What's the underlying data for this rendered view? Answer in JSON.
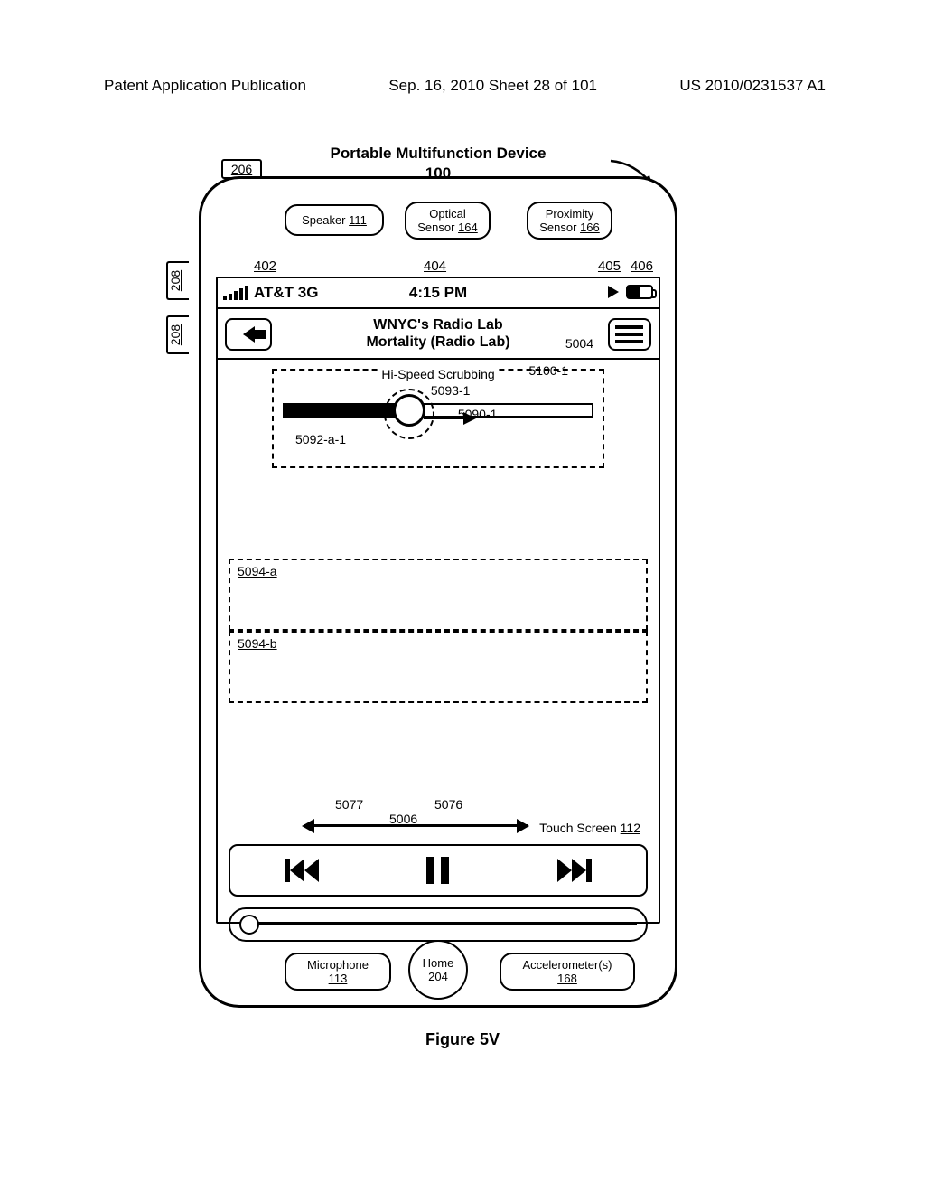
{
  "page_header": {
    "left": "Patent Application Publication",
    "center": "Sep. 16, 2010  Sheet 28 of 101",
    "right": "US 2010/0231537 A1"
  },
  "figure": {
    "title": "Portable Multifunction Device",
    "device_ref": "100",
    "tab_206": "206",
    "side_208": "208",
    "caption": "Figure 5V"
  },
  "top_components": {
    "speaker": {
      "label": "Speaker",
      "ref": "111"
    },
    "optical": {
      "label": "Optical Sensor",
      "ref": "164"
    },
    "proximity": {
      "label": "Proximity Sensor",
      "ref": "166"
    }
  },
  "refs": {
    "r402": "402",
    "r404": "404",
    "r405": "405",
    "r406": "406"
  },
  "status": {
    "carrier": "AT&T 3G",
    "time": "4:15 PM"
  },
  "nav": {
    "title1": "WNYC's Radio Lab",
    "title2": "Mortality (Radio Lab)",
    "ref_5004": "5004"
  },
  "scrub": {
    "label": "Hi-Speed Scrubbing",
    "c_5100_1": "5100-1",
    "c_5093_1": "5093-1",
    "c_5090_1": "5090-1",
    "c_5092_a_1": "5092-a-1"
  },
  "regions": {
    "a": "5094-a",
    "b": "5094-b"
  },
  "arrow_refs": {
    "l": "5077",
    "r": "5076",
    "mid": "5006"
  },
  "touch_screen": {
    "label": "Touch Screen",
    "ref": "112"
  },
  "bottom_components": {
    "mic": {
      "label": "Microphone",
      "ref": "113"
    },
    "home": {
      "label": "Home",
      "ref": "204"
    },
    "acc": {
      "label": "Accelerometer(s)",
      "ref": "168"
    }
  }
}
